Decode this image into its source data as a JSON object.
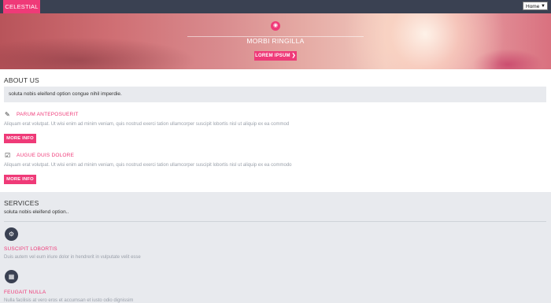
{
  "header": {
    "brand": "CELESTIAL",
    "nav_select": "Home"
  },
  "hero": {
    "title": "MORBI RINGILLA",
    "button": "LOREM IPSUM ❯"
  },
  "about": {
    "heading": "ABOUT US",
    "callout": "soluta nobis eleifend option congue nihil imperdie.",
    "items": [
      {
        "title": "PARUM ANTEPOSUERIT",
        "text": "Aliquam erat volutpat. Ut wisi enim ad minim veniam, quis nostrud exerci tation ullamcorper suscipit lobortis nisl ut aliquip ex ea commod",
        "button": "MORE INFO"
      },
      {
        "title": "AUGUE DUIS DOLORE",
        "text": "Aliquam erat volutpat. Ut wisi enim ad minim veniam, quis nostrud exerci tation ullamcorper suscipit lobortis nisl ut aliquip ex ea commodo",
        "button": "MORE INFO"
      }
    ]
  },
  "services": {
    "heading": "SERVICES",
    "subtitle": "soluta nobis eleifend option..",
    "items": [
      {
        "title": "SUSCIPIT LOBORTIS",
        "text": "Duis autem vel eum iriure dolor in hendrerit in vulputate velit esse"
      },
      {
        "title": "FEUGAIT NULLA",
        "text": "Nulla facilisis at vero eros et accumsan et iusto odio dignissim"
      }
    ]
  },
  "colors": {
    "accent": "#ef3a78",
    "dark": "#3a4152",
    "panel": "#e8eaee"
  }
}
